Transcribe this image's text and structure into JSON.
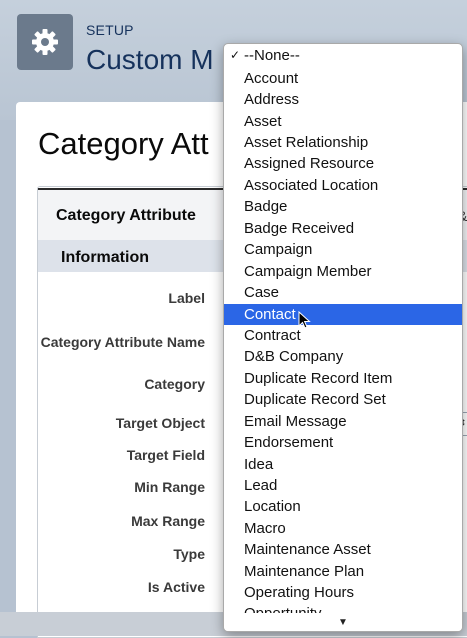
{
  "header": {
    "setup_label": "SETUP",
    "title": "Custom M",
    "icon": "gear-icon"
  },
  "record": {
    "title": "Category Att",
    "detail_header": "Category Attribute",
    "section": "Information"
  },
  "fields": [
    {
      "label": "Label"
    },
    {
      "label": "Category Attribute Name"
    },
    {
      "label": "Category"
    },
    {
      "label": "Target Object"
    },
    {
      "label": "Target Field"
    },
    {
      "label": "Min Range"
    },
    {
      "label": "Max Range"
    },
    {
      "label": "Type"
    },
    {
      "label": "Is Active"
    }
  ],
  "dropdown": {
    "selected_value": "--None--",
    "highlighted": "Contact",
    "options": [
      "--None--",
      "Account",
      "Address",
      "Asset",
      "Asset Relationship",
      "Assigned Resource",
      "Associated Location",
      "Badge",
      "Badge Received",
      "Campaign",
      "Campaign Member",
      "Case",
      "Contact",
      "Contract",
      "D&B Company",
      "Duplicate Record Item",
      "Duplicate Record Set",
      "Email Message",
      "Endorsement",
      "Idea",
      "Lead",
      "Location",
      "Macro",
      "Maintenance Asset",
      "Maintenance Plan",
      "Operating Hours"
    ],
    "partial_option": "Opportunity",
    "check_glyph": "✓",
    "scroll_glyph": "▼"
  },
  "colors": {
    "highlight": "#2b66e6",
    "brand_text": "#16325c"
  }
}
